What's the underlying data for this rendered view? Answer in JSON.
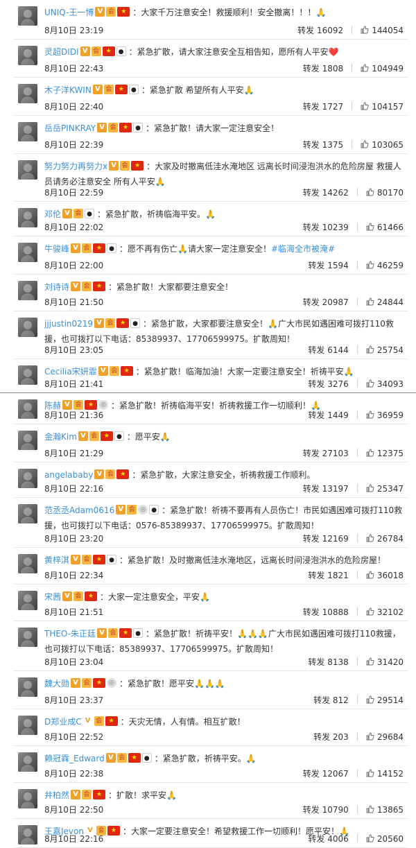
{
  "posts": [
    {
      "user": "UNIQ-王一博",
      "badges": [
        "v",
        "member",
        "flag"
      ],
      "text": "：大家千万注意安全！救援顺利！安全撤离！！！",
      "emoji": "🙏",
      "time": "8月10日 23:19",
      "repost_label": "转发",
      "reposts": "16092",
      "likes": "144054"
    },
    {
      "user": "灵超DIDI",
      "badges": [
        "v",
        "member",
        "flag",
        "panda"
      ],
      "text": "：紧急扩散，请大家注意安全互相告知，愿所有人平安",
      "emoji": "❤️",
      "time": "8月10日 22:43",
      "repost_label": "转发",
      "reposts": "1808",
      "likes": "104949"
    },
    {
      "user": "木子洋KWIN",
      "badges": [
        "v",
        "member",
        "flag",
        "panda"
      ],
      "text": "：紧急扩散 希望所有人平安",
      "emoji": "🙏",
      "time": "8月10日 22:40",
      "repost_label": "转发",
      "reposts": "1727",
      "likes": "104157"
    },
    {
      "user": "岳岳PINKRAY",
      "badges": [
        "v",
        "member",
        "flag",
        "panda"
      ],
      "text": "：紧急扩散！请大家一定注意安全！",
      "emoji": "",
      "time": "8月10日 22:39",
      "repost_label": "转发",
      "reposts": "1375",
      "likes": "103065"
    },
    {
      "user": "努力努力再努力x",
      "badges": [
        "v",
        "member",
        "flag"
      ],
      "text": "：大家及时撤离低洼水淹地区 远离长时间浸泡洪水的危险房屋 救援人员请务必注意安全 所有人平安",
      "emoji": "🙏",
      "time": "8月10日 22:59",
      "repost_label": "转发",
      "reposts": "14262",
      "likes": "80170"
    },
    {
      "user": "邓伦",
      "badges": [
        "v",
        "member",
        "panda"
      ],
      "text": "：紧急扩散，祈祷临海平安。",
      "emoji": "🙏",
      "time": "8月10日 22:02",
      "repost_label": "转发",
      "reposts": "10239",
      "likes": "61466"
    },
    {
      "user": "牛骏峰",
      "badges": [
        "v",
        "member",
        "flag",
        "panda"
      ],
      "text": "：愿不再有伤亡🙏请大家一定注意安全！",
      "hashtag": "#临海全市被淹#",
      "emoji": "",
      "time": "8月10日 22:00",
      "repost_label": "转发",
      "reposts": "1594",
      "likes": "46259"
    },
    {
      "user": "刘诗诗",
      "badges": [
        "v",
        "member",
        "flag"
      ],
      "text": "：紧急扩散！大家都要注意安全！",
      "emoji": "",
      "time": "8月10日 21:50",
      "repost_label": "转发",
      "reposts": "20987",
      "likes": "24844"
    },
    {
      "user": "jjjustin0219",
      "badges": [
        "v",
        "member",
        "flag",
        "panda"
      ],
      "text": "：紧急扩散，大家都要注意安全！🙏广大市民如遇困难可拨打110救援，也可拨打以下电话：85389937、17706599975。扩散周知！",
      "emoji": "",
      "time": "8月10日 23:05",
      "repost_label": "转发",
      "reposts": "6144",
      "likes": "25754"
    },
    {
      "user": "Cecilia宋妍霏",
      "badges": [
        "v",
        "member",
        "flag"
      ],
      "text": "：紧急扩散！临海加油！大家一定要注意安全！祈祷平安",
      "emoji": "🙏",
      "time": "8月10日 21:41",
      "repost_label": "转发",
      "reposts": "3276",
      "likes": "34093"
    },
    {
      "user": "陈赫",
      "badges": [
        "v",
        "member",
        "flag",
        "medal"
      ],
      "text": "：紧急扩散！祈祷临海平安！祈祷救援工作一切顺利！",
      "emoji": "🙏",
      "time": "8月10日 21:36",
      "repost_label": "转发",
      "reposts": "1449",
      "likes": "36959"
    },
    {
      "user": "金瀚Kim",
      "badges": [
        "v",
        "member",
        "flag",
        "panda"
      ],
      "text": "：愿平安",
      "emoji": "🙏",
      "time": "8月10日 21:29",
      "repost_label": "转发",
      "reposts": "27103",
      "likes": "12375"
    },
    {
      "user": "angelababy",
      "badges": [
        "v",
        "member",
        "flag"
      ],
      "text": "：紧急扩散，大家注意安全，祈祷救援工作顺利。",
      "emoji": "",
      "time": "8月10日 22:16",
      "repost_label": "转发",
      "reposts": "13197",
      "likes": "25347"
    },
    {
      "user": "范丞丞Adam0616",
      "badges": [
        "v",
        "member",
        "medal",
        "panda"
      ],
      "text": "：紧急扩散！祈祷不要再有人员伤亡！市民如遇困难可拨打110救援，也可拨打以下电话：0576-85389937、17706599975。扩散周知！",
      "emoji": "",
      "time": "8月10日 23:20",
      "repost_label": "转发",
      "reposts": "12169",
      "likes": "26784"
    },
    {
      "user": "黄梓淇",
      "badges": [
        "v",
        "member",
        "flag",
        "panda"
      ],
      "text": "：紧急扩散！及时撤离低洼水淹地区，远离长时间浸泡洪水的危险房屋！",
      "emoji": "",
      "time": "8月10日 22:34",
      "repost_label": "转发",
      "reposts": "1821",
      "likes": "36018"
    },
    {
      "user": "宋茜",
      "badges": [
        "v",
        "member",
        "flag"
      ],
      "text": "：大家一定注意安全，平安",
      "emoji": "🙏",
      "time": "8月10日 21:51",
      "repost_label": "转发",
      "reposts": "10888",
      "likes": "32102"
    },
    {
      "user": "THEO-朱正廷",
      "badges": [
        "v",
        "member",
        "flag",
        "panda"
      ],
      "text": "：紧急扩散！祈祷平安！🙏🙏🙏广大市民如遇困难可拨打110救援，也可拨打以下电话：85389937、17706599975。扩散周知！",
      "emoji": "",
      "time": "8月10日 23:04",
      "repost_label": "转发",
      "reposts": "8138",
      "likes": "31420"
    },
    {
      "user": "魏大勋",
      "badges": [
        "v",
        "member",
        "flag",
        "medal"
      ],
      "text": "：紧急扩散！愿平安",
      "emoji": "🙏🙏🙏",
      "time": "8月10日 23:37",
      "repost_label": "转发",
      "reposts": "812",
      "likes": "29514"
    },
    {
      "user": "D郑业成C",
      "badges": [
        "vb",
        "member",
        "flag"
      ],
      "text": "：天灾无情，人有情。相互扩散！",
      "emoji": "",
      "time": "8月10日 22:52",
      "repost_label": "转发",
      "reposts": "203",
      "likes": "29684"
    },
    {
      "user": "赖冠霖_Edward",
      "badges": [
        "v",
        "member",
        "flag",
        "panda"
      ],
      "text": "：紧急扩散，祈祷平安。",
      "emoji": "🙏",
      "time": "8月10日 22:38",
      "repost_label": "转发",
      "reposts": "12067",
      "likes": "14152"
    },
    {
      "user": "井柏然",
      "badges": [
        "v",
        "member",
        "flag"
      ],
      "text": "：扩散！求平安",
      "emoji": "🙏",
      "time": "8月10日 22:50",
      "repost_label": "转发",
      "reposts": "10790",
      "likes": "13865"
    },
    {
      "user": "王嘉Jevon",
      "badges": [
        "vb",
        "member",
        "flag"
      ],
      "text": "：大家一定要注意安全！希望救援工作一切顺利！愿平安！",
      "emoji": "🙏",
      "time": "8月10日 22:16",
      "repost_label": "转发",
      "reposts": "4006",
      "likes": "20560"
    }
  ]
}
